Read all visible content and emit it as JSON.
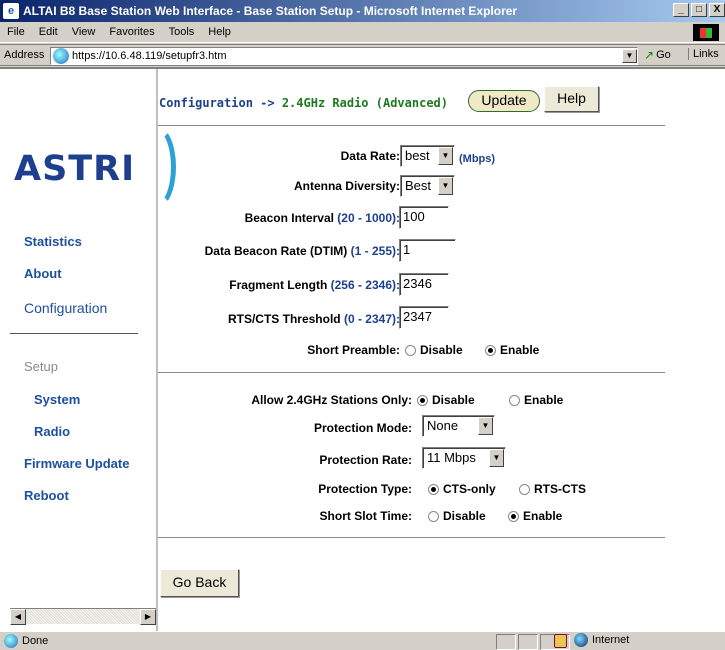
{
  "window": {
    "title": "ALTAI B8 Base Station Web Interface - Base Station Setup - Microsoft Internet Explorer",
    "min": "_",
    "max": "□",
    "close": "X"
  },
  "menu": [
    "File",
    "Edit",
    "View",
    "Favorites",
    "Tools",
    "Help"
  ],
  "address": {
    "label": "Address",
    "url": "https://10.6.48.119/setupfr3.htm",
    "go": "Go",
    "links": "Links"
  },
  "sidebar": {
    "logo": "ASTRI",
    "items": [
      {
        "label": "Statistics"
      },
      {
        "label": "About"
      },
      {
        "label": "Configuration"
      },
      {
        "label": "Setup"
      },
      {
        "label": "System"
      },
      {
        "label": "Radio"
      },
      {
        "label": "Firmware Update"
      },
      {
        "label": "Reboot"
      }
    ]
  },
  "header": {
    "crumb_prefix": "Configuration ->",
    "crumb_page": "2.4GHz Radio (Advanced)",
    "update": "Update",
    "help": "Help"
  },
  "fields": {
    "data_rate": {
      "label": "Data Rate:",
      "value": "best",
      "unit": "(Mbps)"
    },
    "antenna": {
      "label": "Antenna Diversity:",
      "value": "Best"
    },
    "beacon": {
      "label": "Beacon Interval",
      "range": "(20 - 1000):",
      "value": "100"
    },
    "dtim": {
      "label": "Data Beacon Rate (DTIM)",
      "range": "(1 - 255):",
      "value": "1"
    },
    "fragment": {
      "label": "Fragment Length",
      "range": "(256 - 2346):",
      "value": "2346"
    },
    "rts": {
      "label": "RTS/CTS Threshold",
      "range": "(0 - 2347):",
      "value": "2347"
    },
    "preamble": {
      "label": "Short Preamble:",
      "opt1": "Disable",
      "opt2": "Enable",
      "selected": "Enable"
    },
    "stations_only": {
      "label": "Allow 2.4GHz Stations Only:",
      "opt1": "Disable",
      "opt2": "Enable",
      "selected": "Disable"
    },
    "prot_mode": {
      "label": "Protection Mode:",
      "value": "None"
    },
    "prot_rate": {
      "label": "Protection Rate:",
      "value": "11 Mbps"
    },
    "prot_type": {
      "label": "Protection Type:",
      "opt1": "CTS-only",
      "opt2": "RTS-CTS",
      "selected": "CTS-only"
    },
    "slot": {
      "label": "Short Slot Time:",
      "opt1": "Disable",
      "opt2": "Enable",
      "selected": "Enable"
    }
  },
  "go_back": "Go Back",
  "status": {
    "text": "Done",
    "zone": "Internet"
  }
}
